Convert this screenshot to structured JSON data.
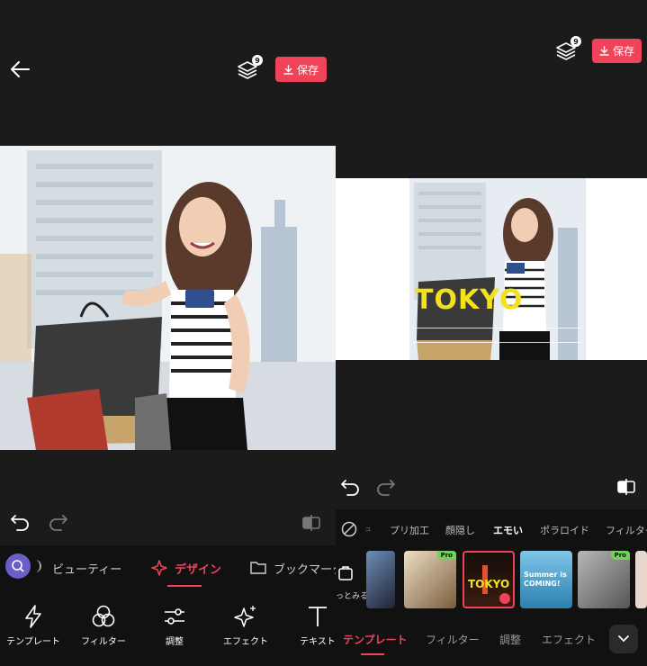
{
  "left": {
    "header": {
      "layers_count": "9",
      "save_label": "保存"
    },
    "category_tabs": [
      {
        "label": "ビューティー"
      },
      {
        "label": "デザイン"
      },
      {
        "label": "ブックマーク"
      }
    ],
    "tools": [
      {
        "label": "テンプレート",
        "icon": "bolt-icon"
      },
      {
        "label": "フィルター",
        "icon": "filter-circles-icon"
      },
      {
        "label": "調整",
        "icon": "sliders-icon"
      },
      {
        "label": "エフェクト",
        "icon": "sparkle-icon"
      },
      {
        "label": "テキスト",
        "icon": "text-icon"
      }
    ]
  },
  "right": {
    "header": {
      "layers_count": "9",
      "save_label": "保存"
    },
    "overlay": {
      "title": "TOKYO"
    },
    "filter_chips": [
      {
        "label": "プリ加工"
      },
      {
        "label": "顔隠し"
      },
      {
        "label": "エモい"
      },
      {
        "label": "ポラロイド"
      },
      {
        "label": "フィルター"
      }
    ],
    "side_label": "っとみる",
    "templates": [
      {
        "pro": "",
        "text": ""
      },
      {
        "pro": "Pro",
        "text": ""
      },
      {
        "pro": "",
        "text": "TOKYO"
      },
      {
        "pro": "",
        "text": "Summer is COMING!"
      },
      {
        "pro": "Pro",
        "text": ""
      },
      {
        "pro": "",
        "text": ""
      }
    ],
    "bottom_tabs": [
      {
        "label": "テンプレート"
      },
      {
        "label": "フィルター"
      },
      {
        "label": "調整"
      },
      {
        "label": "エフェクト"
      }
    ],
    "colors": {
      "accent": "#f0435a",
      "pro_badge": "#6fd35a",
      "tokyo_text": "#f3e11e"
    }
  }
}
